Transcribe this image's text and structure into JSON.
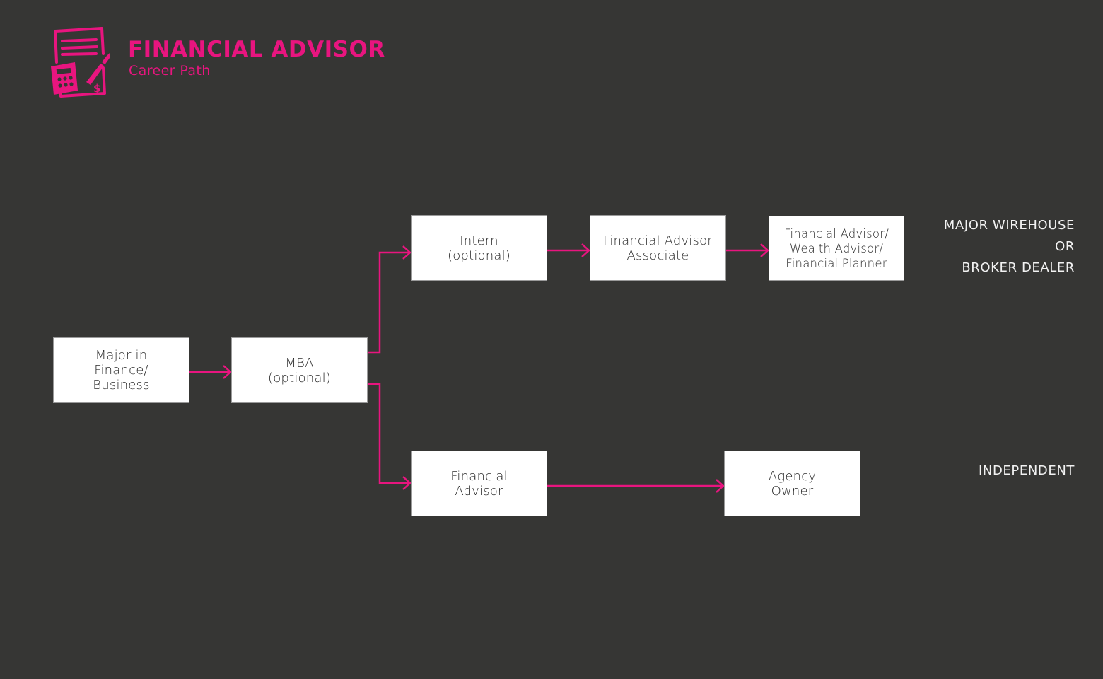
{
  "header": {
    "title": "FINANCIAL ADVISOR",
    "subtitle": "Career Path",
    "icon": "financial-document-calculator-pen-icon"
  },
  "colors": {
    "background": "#363634",
    "accent": "#e8157f",
    "node_fill": "#ffffff",
    "node_text": "#2c2c2c",
    "label_text": "#f2f2f2"
  },
  "nodes": {
    "major": "Major in\nFinance/\nBusiness",
    "mba": "MBA\n(optional)",
    "intern": "Intern\n(optional)",
    "fa_associate": "Financial Advisor\nAssociate",
    "fa_wealth_planner": "Financial Advisor/\nWealth Advisor/\nFinancial Planner",
    "financial_advisor": "Financial\nAdvisor",
    "agency_owner": "Agency\nOwner"
  },
  "edges": [
    {
      "from": "major",
      "to": "mba"
    },
    {
      "from": "mba",
      "to": "intern"
    },
    {
      "from": "intern",
      "to": "fa_associate"
    },
    {
      "from": "fa_associate",
      "to": "fa_wealth_planner"
    },
    {
      "from": "mba",
      "to": "financial_advisor"
    },
    {
      "from": "financial_advisor",
      "to": "agency_owner"
    }
  ],
  "branches": {
    "top": {
      "line1": "MAJOR WIREHOUSE",
      "line2": "OR",
      "line3": "BROKER DEALER"
    },
    "bottom": {
      "line1": "INDEPENDENT"
    }
  }
}
